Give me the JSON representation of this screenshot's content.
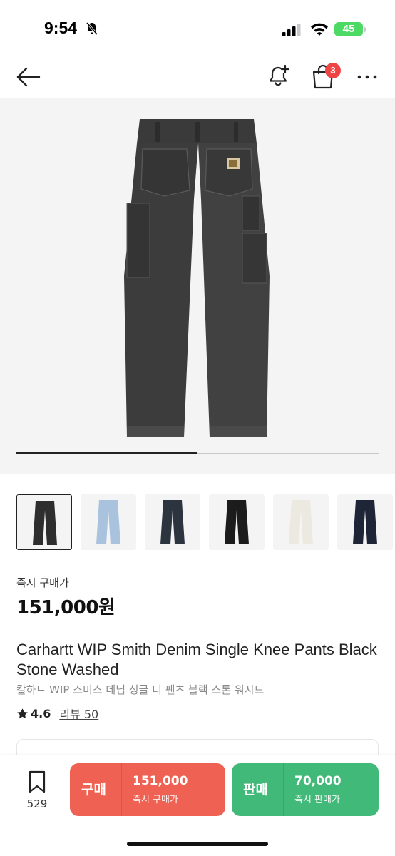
{
  "status_bar": {
    "time": "9:54",
    "battery": "45"
  },
  "nav": {
    "cart_badge": "3",
    "icons": [
      "back-arrow-icon",
      "bell-plus-icon",
      "shopping-bag-icon",
      "more-icon"
    ]
  },
  "gallery": {
    "progress": 0.5
  },
  "thumbnails": [
    {
      "name": "black-stone",
      "color": "#2e2e2e",
      "selected": true
    },
    {
      "name": "light-blue",
      "color": "#a9c3de",
      "selected": false
    },
    {
      "name": "dark-blue",
      "color": "#2c3440",
      "selected": false
    },
    {
      "name": "black",
      "color": "#1c1c1c",
      "selected": false
    },
    {
      "name": "white",
      "color": "#ece9e0",
      "selected": false
    },
    {
      "name": "navy",
      "color": "#1d2536",
      "selected": false
    }
  ],
  "price": {
    "label": "즉시 구매가",
    "value": "151,000원"
  },
  "product": {
    "title": "Carhartt WIP Smith Denim Single Knee Pants Black Stone Washed",
    "subtitle": "칼하트 WIP 스미스 데님 싱글 니 팬츠 블랙 스톤 워시드",
    "rating": "4.6",
    "reviews": "리뷰 50"
  },
  "bottom_bar": {
    "wish_count": "529",
    "buy": {
      "label": "구매",
      "price": "151,000",
      "sub": "즉시 구매가"
    },
    "sell": {
      "label": "판매",
      "price": "70,000",
      "sub": "즉시 판매가"
    }
  },
  "colors": {
    "buy": "#ef6253",
    "sell": "#41b979",
    "badge": "#ef4444"
  }
}
